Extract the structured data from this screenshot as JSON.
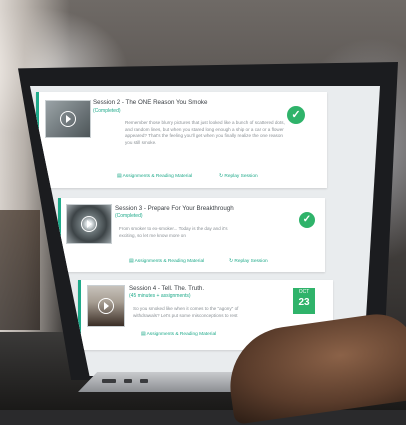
{
  "sessions": [
    {
      "title": "Session 2 - The ONE Reason You Smoke",
      "status": "(Completed)",
      "description": "Remember those blurry pictures that just looked like a bunch of scattered dots, and random lines, but when you stared long enough a ship or a car or a flower appeared? That's the feeling you'll get when you finally realize the one reason you still smoke.",
      "links": [
        "Assignments & Reading Material",
        "Replay Session"
      ],
      "badge": "check"
    },
    {
      "title": "Session 3 - Prepare For Your Breakthrough",
      "status": "(Completed)",
      "description": "From smoker to ex-smoker... Today is the day and it's exciting, so let me know more on",
      "links": [
        "Assignments & Reading Material",
        "Replay Session"
      ],
      "badge": "check"
    },
    {
      "title": "Session 4 - Tell. The. Truth.",
      "status": "(45 minutes + assignments)",
      "description": "So you smoked like when it comes to the \"agony\" of withdrawals? Let's put some misconceptions to rest",
      "links": [
        "Assignments & Reading Material"
      ],
      "badge": "date",
      "date": {
        "month": "OCT",
        "day": "23"
      }
    }
  ],
  "icons": {
    "check": "checkmark-icon",
    "play": "play-icon",
    "doc": "document-icon",
    "replay": "replay-icon"
  },
  "colors": {
    "accent": "#1faa8a",
    "badge_green": "#2fb36a"
  }
}
